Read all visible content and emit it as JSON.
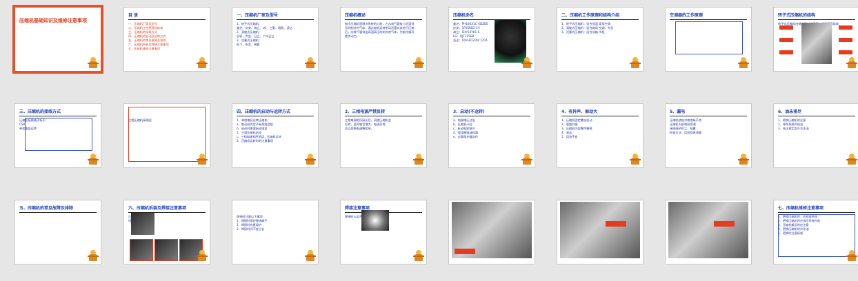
{
  "slides": [
    {
      "title": "压缩机基础知识及维修注意事项",
      "body": []
    },
    {
      "title": "目 录",
      "body": [
        "一、压缩机厂家及型号",
        "二、压缩机工作原理及结构",
        "三、压缩机的接线方式",
        "四、压缩机的启动及运转方式",
        "五、压缩机的常见故障及排除",
        "六、压缩机拆装及焊接注意事项",
        "七、压缩机维修注意事项"
      ]
    },
    {
      "title": "一、压缩机厂家及型号",
      "body": [
        "1、转子式压缩机：",
        "美芝、庆安、海立、LG、三菱、瑞智、凌达",
        "2、涡旋式压缩机：",
        "谷轮、大金、日立、广州日立",
        "3、活塞式压缩机：",
        "松下、东芝、瑞智"
      ]
    },
    {
      "title": "压缩机概述",
      "body": [
        "制冷压缩机是制冷系统的心脏，它从吸气管吸入低温低",
        "压的制冷剂气体，通过电机运转带动活塞对其进行压缩",
        "后，向排气管排出高温高压的制冷剂气体，为制冷循环",
        "提供动力。"
      ]
    },
    {
      "title": "压缩机命名",
      "body": [
        "美芝：PH180X1C-4DZDE",
        "庆安：1FKSRD2-1V",
        "海立：SHY33YK1-S",
        "LG：QJT215EB",
        "凌达：QXA-B120zC170A"
      ]
    },
    {
      "title": "二、压缩机工作原理和结构介绍",
      "body": [
        "1、转子式压缩机：适合低温 家用空调",
        "2、涡旋式压缩机：适合商用 空调、大型",
        "3、活塞式压缩机：适合冰箱 冷柜"
      ]
    },
    {
      "title": "空调器的工作原理",
      "body": []
    },
    {
      "title": "转子式压缩机的结构",
      "body": [
        "转子式压缩机由储液器、排气管、吸气管等组成"
      ]
    },
    {
      "title": "三、压缩机的接线方式",
      "body": [
        "压缩机接线端子标识",
        "CSR",
        "单相电容运转"
      ]
    },
    {
      "title": "",
      "body": [
        "三相压缩机接线图"
      ]
    },
    {
      "title": "四、压缩机的启动与运转方式",
      "body": [
        "1、单相电容运转压缩机：",
        "a、电动机的定子有两组绕组",
        "b、启动时需要启动电容",
        "2、三相压缩机启动",
        "c、三相电源相序错误，压缩机反转",
        "3、压缩机运转时的注意事项"
      ]
    },
    {
      "title": "2、三相电源严禁反转",
      "body": [
        "三相电源相序接反后，涡旋压缩机会",
        "反转，此时噪音增大，电流异常，",
        "应立即断电调整相序。"
      ]
    },
    {
      "title": "3、启动(不运转)",
      "body": [
        "a、电源电压过低",
        "b、压缩机卡缸",
        "c、启动电容损坏",
        "d、绕组断路或短路",
        "e、过载保护器动作"
      ]
    },
    {
      "title": "4、有异声、振动大",
      "body": [
        "1、压缩机固定螺丝松动",
        "2、管路共振",
        "3、压缩机内部零件磨损",
        "4、液击",
        "5、回油不良"
      ]
    },
    {
      "title": "5、漏电",
      "body": [
        "压缩机绕组对地绝缘不良",
        "压缩机内部电机受潮",
        "接线端子积尘、结露",
        "检查方法：用兆欧表测量"
      ]
    },
    {
      "title": "6、油未排尽",
      "body": [
        "1、更换压缩机时注意",
        "2、排净系统内残油",
        "3、充注规定型号冷冻油"
      ]
    },
    {
      "title": "五、压缩机的常见故障及排除",
      "body": []
    },
    {
      "title": "六、压缩机拆装及焊接注意事项",
      "body": [
        "正确方法",
        "错误方法"
      ]
    },
    {
      "title": "",
      "body": [
        "焊接时注意以下事项",
        "1、焊接时保护接线端子",
        "2、焊接时充氮保护",
        "3、焊接时间不宜过长"
      ]
    },
    {
      "title": "焊接注意事项",
      "body": [
        "焊接时火焰不能对准接线盒"
      ]
    },
    {
      "title": "",
      "body": [
        "压缩机焊接示意"
      ]
    },
    {
      "title": "",
      "body": [
        "焊接位置示意"
      ]
    },
    {
      "title": "",
      "body": [
        "焊接时保护接线端子"
      ]
    },
    {
      "title": "七、压缩机维修注意事项",
      "body": [
        "1、更换压缩机时，应检查系统",
        "2、更换压缩机时应排尽系统内的",
        "3、压缩机搬运时应注意",
        "4、更换压缩机时冷冻油",
        "5、更换时注意接线"
      ]
    }
  ]
}
